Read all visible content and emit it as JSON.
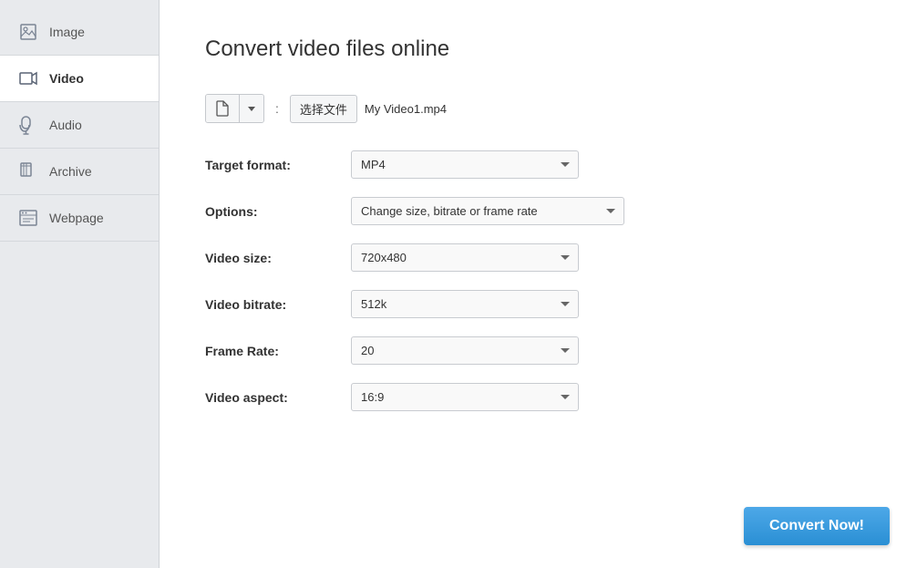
{
  "sidebar": {
    "items": [
      {
        "id": "image",
        "label": "Image",
        "active": false
      },
      {
        "id": "video",
        "label": "Video",
        "active": true
      },
      {
        "id": "audio",
        "label": "Audio",
        "active": false
      },
      {
        "id": "archive",
        "label": "Archive",
        "active": false
      },
      {
        "id": "webpage",
        "label": "Webpage",
        "active": false
      }
    ]
  },
  "main": {
    "title": "Convert video files online",
    "file_section": {
      "colon": ":",
      "choose_btn_label": "选择文件",
      "file_name": "My Video1.mp4"
    },
    "form": {
      "target_format_label": "Target format:",
      "target_format_value": "MP4",
      "options_label": "Options:",
      "options_value": "Change size, bitrate or frame rate",
      "video_size_label": "Video size:",
      "video_size_value": "720x480",
      "video_bitrate_label": "Video bitrate:",
      "video_bitrate_value": "512k",
      "frame_rate_label": "Frame Rate:",
      "frame_rate_value": "20",
      "video_aspect_label": "Video aspect:",
      "video_aspect_value": "16:9"
    },
    "convert_btn_label": "Convert Now!"
  }
}
